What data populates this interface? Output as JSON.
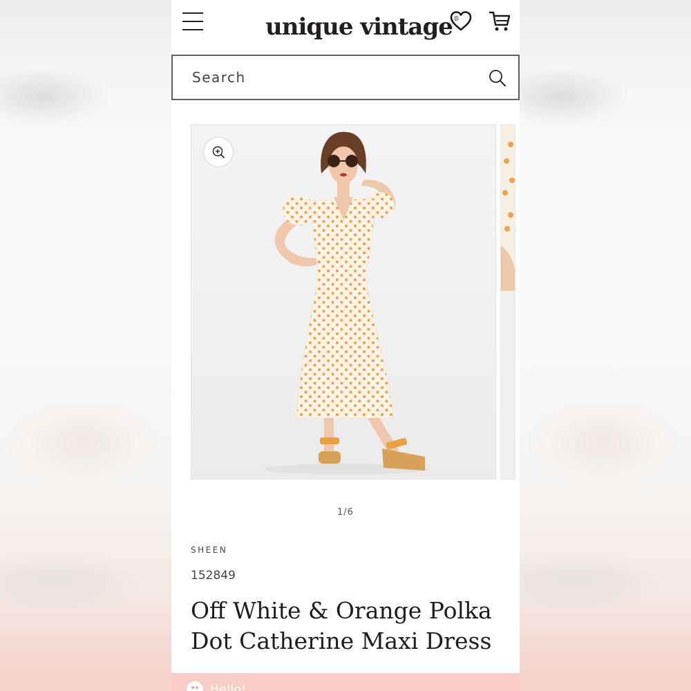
{
  "header": {
    "logo_text": "unique vintage",
    "logo_mark": "®",
    "icons": [
      "menu-icon",
      "heart-icon",
      "cart-icon"
    ]
  },
  "search": {
    "placeholder": "Search",
    "icon": "search-icon"
  },
  "gallery": {
    "counter": "1/6",
    "zoom_icon": "zoom-in-icon",
    "dress_color": "#fbf3e6",
    "dot_color": "#f0a24a"
  },
  "product": {
    "vendor": "SHEEN",
    "sku": "152849",
    "title": "Off White & Orange Polka Dot Catherine Maxi Dress"
  },
  "chat": {
    "text": "Hello!",
    "bar_color": "#f7cdc5"
  }
}
